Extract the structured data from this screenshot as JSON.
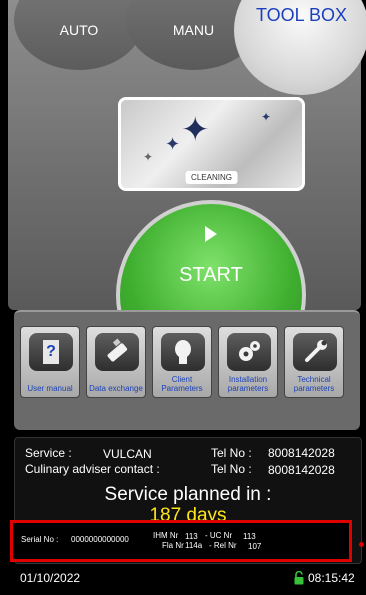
{
  "tabs": {
    "auto": "AUTO",
    "manu": "MANU",
    "toolbox": "TOOL BOX"
  },
  "program": {
    "label": "CLEANING"
  },
  "start": {
    "label": "START"
  },
  "tools": [
    {
      "label": "User manual",
      "icon": "help-manual-icon"
    },
    {
      "label": "Data exchange",
      "icon": "usb-stick-icon"
    },
    {
      "label": "Client Parameters",
      "icon": "person-head-icon"
    },
    {
      "label": "Installation parameters",
      "icon": "gears-icon"
    },
    {
      "label": "Technical parameters",
      "icon": "wrench-icon"
    }
  ],
  "service": {
    "service_label": "Service :",
    "service_name": "VULCAN",
    "tel_label": "Tel No :",
    "tel_value": "8008142028",
    "contact_label": "Culinary adviser contact :",
    "contact_tel_label": "Tel No :",
    "contact_tel_value": "8008142028",
    "planned_label": "Service planned in :",
    "days": "187 days"
  },
  "serial": {
    "serial_label": "Serial No :",
    "serial_value": "0000000000000",
    "ihm_label": "IHM Nr",
    "ihm_value": "113",
    "uc_label": "- UC Nr",
    "uc_value": "113",
    "fla_label": "Fla Nr",
    "fla_value": "114a",
    "rel_label": "- Rel Nr",
    "rel_value": "107"
  },
  "status": {
    "date": "01/10/2022",
    "time": "08:15:42"
  },
  "colors": {
    "start_green": "#3fae2f",
    "toolbox_blue": "#1b3fbf",
    "days_yellow": "#ffe619",
    "highlight_red": "#e00000",
    "lock_green": "#39c13a"
  }
}
